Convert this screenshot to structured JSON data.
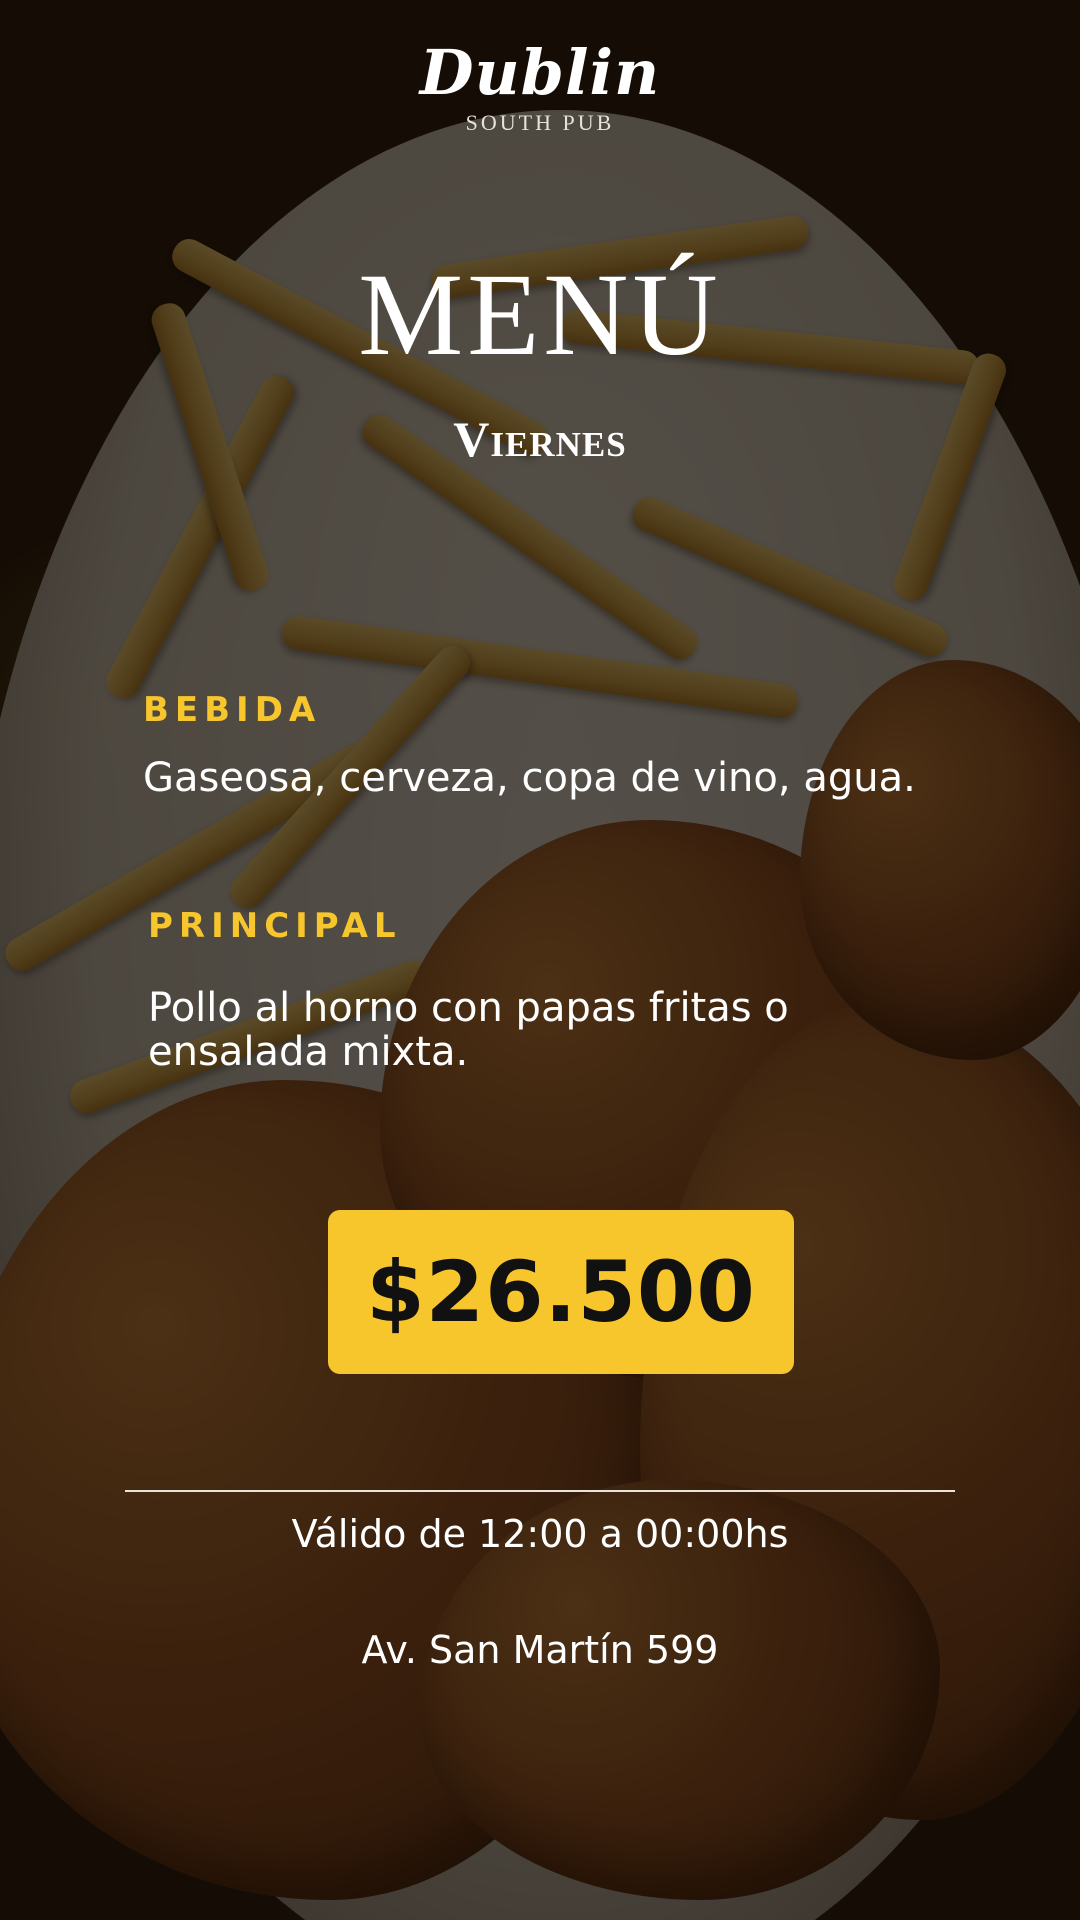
{
  "logo": {
    "name": "Dublin",
    "tagline": "SOUTH PUB"
  },
  "header": {
    "title": "MENÚ",
    "day": "Viernes"
  },
  "sections": [
    {
      "label": "BEBIDA",
      "text": "Gaseosa, cerveza, copa de vino, agua."
    },
    {
      "label": "PRINCIPAL",
      "text": "Pollo al horno con papas fritas o ensalada mixta."
    }
  ],
  "price": "$26.500",
  "footer": {
    "validity": "Válido de 12:00 a 00:00hs",
    "address": "Av. San Martín 599"
  },
  "colors": {
    "accent": "#f7c52c",
    "text": "#ffffff",
    "price_text": "#111111"
  }
}
